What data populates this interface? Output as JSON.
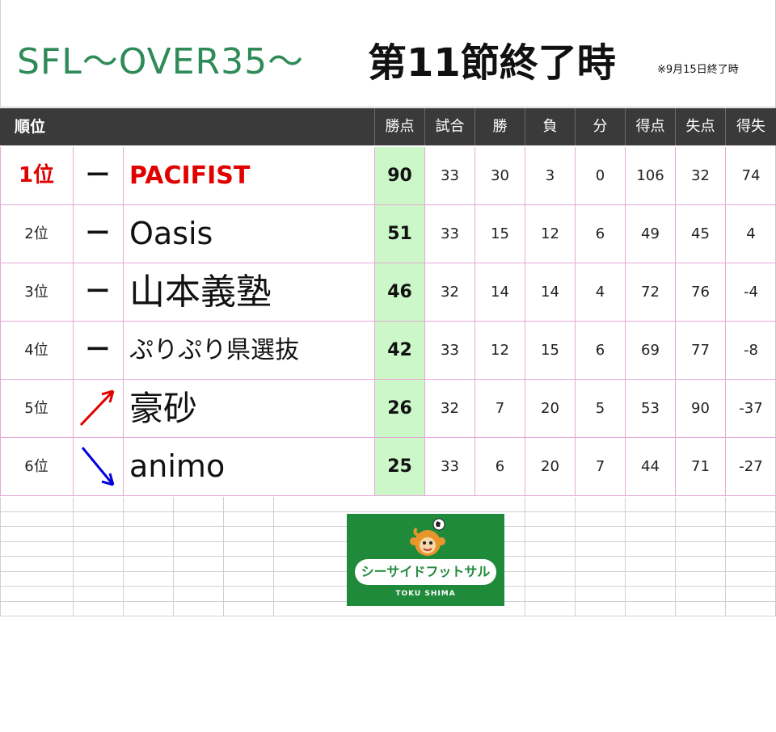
{
  "header": {
    "title": "SFL～OVER35～",
    "round": "第11節終了時",
    "note": "※9月15日終了時"
  },
  "columns": {
    "rank": "順位",
    "points": "勝点",
    "played": "試合",
    "won": "勝",
    "lost": "負",
    "drawn": "分",
    "goals_for": "得点",
    "goals_against": "失点",
    "goal_diff": "得失"
  },
  "rows": [
    {
      "rank": "1位",
      "move": "ー",
      "move_type": "same",
      "team": "PACIFIST",
      "points": "90",
      "played": "33",
      "won": "30",
      "lost": "3",
      "drawn": "0",
      "gf": "106",
      "ga": "32",
      "gd": "74"
    },
    {
      "rank": "2位",
      "move": "ー",
      "move_type": "same",
      "team": "Oasis",
      "points": "51",
      "played": "33",
      "won": "15",
      "lost": "12",
      "drawn": "6",
      "gf": "49",
      "ga": "45",
      "gd": "4"
    },
    {
      "rank": "3位",
      "move": "ー",
      "move_type": "same",
      "team": "山本義塾",
      "points": "46",
      "played": "32",
      "won": "14",
      "lost": "14",
      "drawn": "4",
      "gf": "72",
      "ga": "76",
      "gd": "-4"
    },
    {
      "rank": "4位",
      "move": "ー",
      "move_type": "same",
      "team": "ぷりぷり県選抜",
      "points": "42",
      "played": "33",
      "won": "12",
      "lost": "15",
      "drawn": "6",
      "gf": "69",
      "ga": "77",
      "gd": "-8"
    },
    {
      "rank": "5位",
      "move": "",
      "move_type": "up",
      "team": "豪砂",
      "points": "26",
      "played": "32",
      "won": "7",
      "lost": "20",
      "drawn": "5",
      "gf": "53",
      "ga": "90",
      "gd": "-37"
    },
    {
      "rank": "6位",
      "move": "",
      "move_type": "down",
      "team": "animo",
      "points": "25",
      "played": "33",
      "won": "6",
      "lost": "20",
      "drawn": "7",
      "gf": "44",
      "ga": "71",
      "gd": "-27"
    }
  ],
  "logo": {
    "main": "シーサイドフットサル",
    "sub": "TOKU SHIMA"
  },
  "colors": {
    "title_green": "#2e8b57",
    "header_bg": "#3a3a3a",
    "points_bg": "#ccf7c8",
    "leader_red": "#e00000",
    "up_arrow": "#e00000",
    "down_arrow": "#0000dd",
    "row_border": "#e6a9d8"
  }
}
